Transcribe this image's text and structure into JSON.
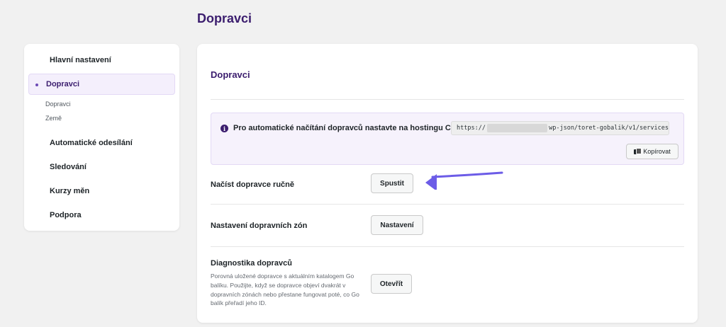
{
  "page": {
    "title": "Dopravci"
  },
  "sidebar": {
    "items": [
      {
        "label": "Hlavní nastavení"
      },
      {
        "label": "Dopravci"
      },
      {
        "label": "Automatické odesílání"
      },
      {
        "label": "Sledování"
      },
      {
        "label": "Kurzy měn"
      },
      {
        "label": "Podpora"
      }
    ],
    "subitems": [
      {
        "label": "Dopravci"
      },
      {
        "label": "Země"
      }
    ]
  },
  "card": {
    "title": "Dopravci",
    "notice": {
      "icon": "info-icon",
      "text": "Pro automatické načítání dopravců nastavte na hostingu CRON",
      "url_prefix": "https://",
      "url_suffix": "wp-json/toret-gobalik/v1/services",
      "copy_label": "Kopírovat"
    },
    "rows": [
      {
        "label": "Načíst dopravce ručně",
        "button": "Spustit"
      },
      {
        "label": "Nastavení dopravních zón",
        "button": "Nastavení"
      },
      {
        "label": "Diagnostika dopravců",
        "description": "Porovná uložené dopravce s aktuálním katalogem Go balíku. Použijte, když se dopravce objeví dvakrát v dopravních zónách nebo přestane fungovat poté, co Go balík přeřadí jeho ID.",
        "button": "Otevřít"
      }
    ]
  },
  "colors": {
    "accent": "#3b1d6e",
    "arrow": "#6c5ce7"
  }
}
